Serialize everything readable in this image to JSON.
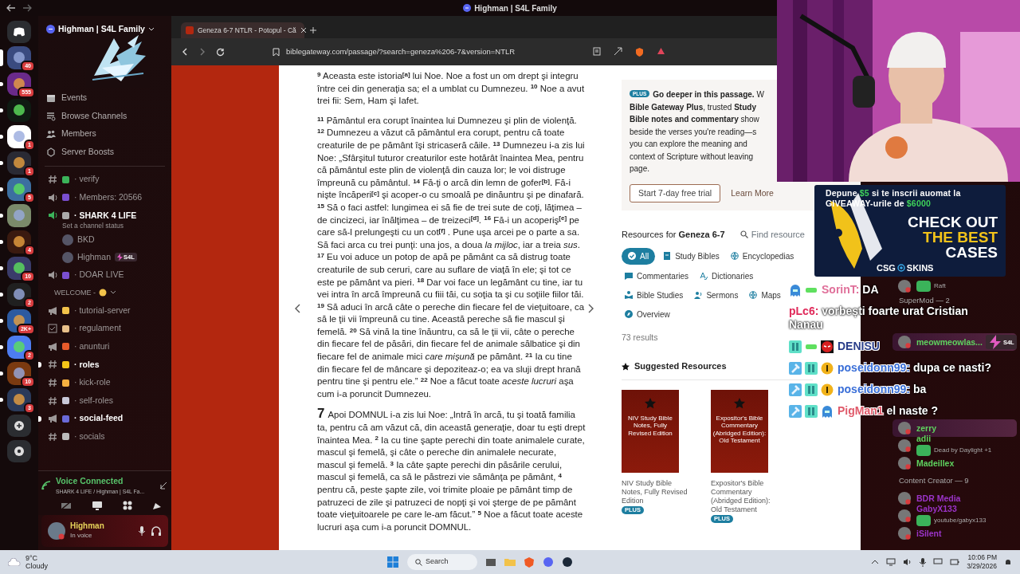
{
  "top_bar": {
    "title": "Highman | S4L Family"
  },
  "servers": [
    {
      "selected": true,
      "badge": "40"
    },
    {
      "selected": false,
      "badge": "555"
    },
    {
      "selected": false
    },
    {
      "selected": false,
      "badge": "1"
    },
    {
      "selected": false,
      "badge": "1"
    },
    {
      "selected": false,
      "badge": "5"
    },
    {
      "selected": false
    },
    {
      "selected": false,
      "badge": "4"
    },
    {
      "selected": false,
      "badge": "10"
    },
    {
      "selected": false,
      "badge": "2"
    },
    {
      "selected": false,
      "badge": "2K+"
    },
    {
      "selected": false,
      "badge": "2"
    },
    {
      "selected": false,
      "badge": "10"
    },
    {
      "selected": false,
      "badge": "3"
    }
  ],
  "server": {
    "name": "Highman | S4L Family"
  },
  "menu": [
    {
      "kind": "events",
      "label": "Events"
    },
    {
      "kind": "browse",
      "label": "Browse Channels"
    },
    {
      "kind": "members",
      "label": "Members"
    },
    {
      "kind": "boosts",
      "label": "Server Boosts"
    }
  ],
  "channels": [
    {
      "kind": "text",
      "name": "· verify",
      "unread": false,
      "active": false
    },
    {
      "kind": "voice",
      "name": "· Members: 20566",
      "unread": false,
      "active": false
    },
    {
      "kind": "voice",
      "name": "· SHARK 4 LIFE",
      "unread": false,
      "active": true,
      "status": "Set a channel status",
      "users": [
        {
          "name": "BKD"
        },
        {
          "name": "Highman",
          "tag": "S4L"
        }
      ]
    },
    {
      "kind": "voice",
      "name": "· DOAR LIVE",
      "unread": false,
      "active": false
    },
    {
      "kind": "category",
      "name": "WELCOME -"
    },
    {
      "kind": "announcement",
      "name": "· tutorial-server",
      "unread": false,
      "active": false
    },
    {
      "kind": "rules",
      "name": "· regulament",
      "unread": false,
      "active": false
    },
    {
      "kind": "announcement",
      "name": "· anunturi",
      "unread": false,
      "active": false
    },
    {
      "kind": "text",
      "name": "· roles",
      "unread": true,
      "active": false
    },
    {
      "kind": "text",
      "name": "· kick-role",
      "unread": false,
      "active": false
    },
    {
      "kind": "text",
      "name": "· self-roles",
      "unread": false,
      "active": false
    },
    {
      "kind": "announcement",
      "name": "· social-feed",
      "unread": true,
      "active": false
    },
    {
      "kind": "text",
      "name": "· socials",
      "unread": false,
      "active": false
    }
  ],
  "voice_panel": {
    "title": "Voice Connected",
    "location": "SHARK 4 LIFE / Highman | S4L Fa..."
  },
  "user_panel": {
    "name": "Highman",
    "status": "In voice"
  },
  "browser": {
    "tab": "Geneza 6-7 NTLR - Potopul - Că",
    "url": "biblegateway.com/passage/?search=geneza%206-7&version=NTLR"
  },
  "passage": [
    {
      "kind": "verses",
      "text": "$^{9}$ Aceasta este istoria$^{[a]}$ lui Noe. Noe a fost un om drept şi integru între cei din generaţia sa; el a umblat cu Dumnezeu. $^{10}$ Noe a avut trei fii: Sem, Ham şi Iafet."
    },
    {
      "kind": "verses",
      "text": "$^{11}$ Pământul era corupt înaintea lui Dumnezeu şi plin de violenţă. $^{12}$ Dumnezeu a văzut că pământul era corupt, pentru că toate creaturile de pe pământ îşi stricaseră căile. $^{13}$ Dumnezeu i-a zis lui Noe: „Sfârşitul tuturor creaturilor este hotărât înaintea Mea, pentru că pământul este plin de violenţă din cauza lor; le voi distruge împreună cu pământul. $^{14}$ Fă-ţi o arcă din lemn de gofer$^{[b]}$. Fă-i nişte încăperi$^{[c]}$ şi acoper-o cu smoală pe dinăuntru şi pe dinafară. $^{15}$ Să o faci astfel: lungimea ei să fie de trei sute de coţi, lăţimea – de cincizeci, iar înălţimea – de treizeci$^{[d]}$. $^{16}$ Fă-i un acoperiş$^{[e]}$ pe care să-l prelungeşti cu un cot$^{[f]}$ . Pune uşa arcei pe o parte a sa. Să faci arca cu trei punţi: una jos, a doua *la mijloc*, iar a treia *sus*. $^{17}$ Eu voi aduce un potop de apă pe pământ ca să distrug toate creaturile de sub ceruri, care au suflare de viaţă în ele; şi tot ce este pe pământ va pieri. $^{18}$ Dar voi face un legământ cu tine, iar tu vei intra în arcă împreună cu fiii tăi, cu soţia ta şi cu soţiile fiilor tăi. $^{19}$ Să aduci în arcă câte o pereche din fiecare fel de vieţuitoare, ca să le ţii vii împreună cu tine. Această pereche să fie mascul şi femelă. $^{20}$ Să vină la tine înăuntru, ca să le ţii vii, câte o pereche din fiecare fel de păsări, din fiecare fel de animale sălbatice şi din fiecare fel de animale mici *care mişună* pe pământ. $^{21}$ Ia cu tine din fiecare fel de mâncare şi depoziteaz-o; ea va sluji drept hrană pentru tine şi pentru ele.” $^{22}$ Noe a făcut toate *aceste lucruri* aşa cum i-a poruncit Dumnezeu."
    },
    {
      "kind": "chapter",
      "chapter": "7",
      "text": "Apoi DOMNUL i-a zis lui Noe: „Intră în arcă, tu şi toată familia ta, pentru că am văzut că, din această generaţie, doar tu eşti drept înaintea Mea. $^{2}$ Ia cu tine şapte perechi din toate animalele curate, mascul şi femelă, şi câte o pereche din animalele necurate, mascul şi femelă. $^{3}$ Ia câte şapte perechi din păsările cerului, mascul şi femelă, ca să le păstrezi vie sămânţa pe pământ, $^{4}$ pentru că, peste şapte zile, voi trimite ploaie pe pământ timp de patruzeci de zile şi patruzeci de nopţi şi voi şterge de pe pământ toate vieţuitoarele pe care le-am făcut.” $^{5}$ Noe a făcut toate aceste lucruri aşa cum i-a poruncit DOMNUL."
    }
  ],
  "promo": {
    "badge": "PLUS",
    "lines": [
      "**Go deeper in this passage.** W",
      "**Bible Gateway Plus**, trusted **Study**",
      "**Bible notes and commentary** show",
      "beside the verses you're reading—s",
      "you can explore the meaning and",
      "context of Scripture without leaving",
      "page."
    ],
    "button": "Start 7-day free trial",
    "link": "Learn More"
  },
  "resources": {
    "title": "Resources for **Geneza 6-7**",
    "find": "Find resource",
    "filters": [
      {
        "kind": "all",
        "label": "All",
        "selected": true
      },
      {
        "kind": "book",
        "label": "Study Bibles",
        "selected": false
      },
      {
        "kind": "globe",
        "label": "Encyclopedias",
        "selected": false
      },
      {
        "kind": "comment",
        "label": "Commentaries",
        "selected": false
      },
      {
        "kind": "dict",
        "label": "Dictionaries",
        "selected": false
      },
      {
        "kind": "study",
        "label": "Bible Studies",
        "selected": false
      },
      {
        "kind": "sermon",
        "label": "Sermons",
        "selected": false
      },
      {
        "kind": "globe",
        "label": "Maps",
        "selected": false
      },
      {
        "kind": "compass",
        "label": "Overview",
        "selected": false
      }
    ],
    "results": "73 results",
    "suggested": "Suggested Resources",
    "books": [
      {
        "cover": "NIV Study Bible Notes, Fully Revised Edition",
        "caption": "NIV Study Bible Notes, Fully Revised Edition",
        "badge": "PLUS"
      },
      {
        "cover": "Expositor's Bible Commentary (Abridged Edition): Old Testament",
        "caption": "Expositor's Bible Commentary (Abridged Edition): Old Testament",
        "badge": "PLUS"
      }
    ]
  },
  "members": [
    {
      "kind": "member",
      "activity": "Raft"
    },
    {
      "kind": "category",
      "name": "SuperMod — 2"
    },
    {
      "kind": "member",
      "name": "meowmeowlas...",
      "tag": "S4L",
      "color": "#5fd35f",
      "highlight": true
    },
    {
      "kind": "member",
      "name": "zerry",
      "color": "#5fd35f",
      "highlight": true
    },
    {
      "kind": "member",
      "name": "adii",
      "activity": "Dead by Daylight +1",
      "color": "#5fd35f",
      "highlight": false
    },
    {
      "kind": "member",
      "name": "Madeillex",
      "color": "#5fd35f",
      "highlight": false
    },
    {
      "kind": "category",
      "name": "Content Creator — 9"
    },
    {
      "kind": "member",
      "name": "BDR Media",
      "color": "#9b34c8",
      "highlight": false
    },
    {
      "kind": "member",
      "name": "GabyX133",
      "activity": "youtube/gabyx133",
      "color": "#9b34c8",
      "highlight": false
    },
    {
      "kind": "member",
      "name": "iSilent",
      "color": "#9b34c8",
      "highlight": false
    }
  ],
  "ad": {
    "lines": [
      [
        {
          "text": "Depune ",
          "highlight": false
        },
        {
          "text": "$5",
          "highlight": true
        },
        {
          "text": " si te inscrii auomat la",
          "highlight": false
        }
      ],
      [
        {
          "text": "GIVEAWAY-urile de ",
          "highlight": false
        },
        {
          "text": "$6000",
          "highlight": true
        }
      ]
    ],
    "big": [
      {
        "text": "CHECK OUT",
        "highlight": false
      },
      {
        "text": "THE BEST",
        "highlight": true
      },
      {
        "text": "CASES",
        "highlight": false
      }
    ],
    "brand": [
      "CSG",
      "SKINS"
    ]
  },
  "chat": [
    {
      "user": "SorinT:",
      "color": "#e0709a",
      "text": "DA",
      "badges": [
        {
          "kind": "ghost"
        },
        {
          "kind": "bar"
        }
      ]
    },
    {
      "user": "pLc6:",
      "color": "#e02a5a",
      "text": "vorbești foarte urat Cristian Nanau"
    },
    {
      "user": "DENISU",
      "color": "#2a3e8a",
      "badges": [
        {
          "kind": "sub"
        },
        {
          "kind": "bar"
        },
        {
          "kind": "mask"
        }
      ]
    },
    {
      "user": "poseidonn99:",
      "color": "#3a6fd8",
      "text": "dupa ce nasti?",
      "badges": [
        {
          "kind": "hammer"
        },
        {
          "kind": "sub"
        },
        {
          "kind": "coin"
        }
      ]
    },
    {
      "user": "poseidonn99:",
      "color": "#3a6fd8",
      "text": "ba",
      "badges": [
        {
          "kind": "hammer"
        },
        {
          "kind": "sub"
        },
        {
          "kind": "coin"
        }
      ]
    },
    {
      "user": "PigMan1",
      "color": "#e05a6a",
      "text": "el naste ?",
      "badges": [
        {
          "kind": "hammer"
        },
        {
          "kind": "sub"
        },
        {
          "kind": "ghost"
        }
      ]
    }
  ],
  "taskbar": {
    "temperature": "9°C",
    "weather": "Cloudy",
    "search": "Search",
    "time": "10:06 PM",
    "date": "3/29/2026"
  }
}
